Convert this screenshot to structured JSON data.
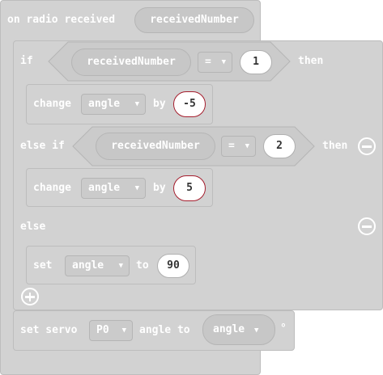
{
  "event_block": {
    "label": "on radio received",
    "param": "receivedNumber"
  },
  "if_block": {
    "if_label": "if",
    "then_label": "then",
    "else_if_label": "else if",
    "else_label": "else",
    "condition1": {
      "left": "receivedNumber",
      "op": "=",
      "right": "1"
    },
    "condition2": {
      "left": "receivedNumber",
      "op": "=",
      "right": "2"
    }
  },
  "change1": {
    "label": "change",
    "variable": "angle",
    "by_label": "by",
    "value": "-5"
  },
  "change2": {
    "label": "change",
    "variable": "angle",
    "by_label": "by",
    "value": "5"
  },
  "set_block": {
    "label": "set",
    "variable": "angle",
    "to_label": "to",
    "value": "90"
  },
  "servo_block": {
    "label": "set servo",
    "pin": "P0",
    "angle_label": "angle to",
    "value_var": "angle",
    "degree": "°"
  },
  "dropdown_arrow": "▼",
  "colors": {
    "block": "#d2d2d2",
    "border": "#bdbdbd",
    "pill": "#c7c7c7",
    "value_outline": "#a51d2d",
    "text": "#ffffff"
  },
  "icons": {
    "remove_else_if": "minus-circle-icon",
    "remove_else": "minus-circle-icon",
    "add_branch": "plus-circle-icon"
  }
}
